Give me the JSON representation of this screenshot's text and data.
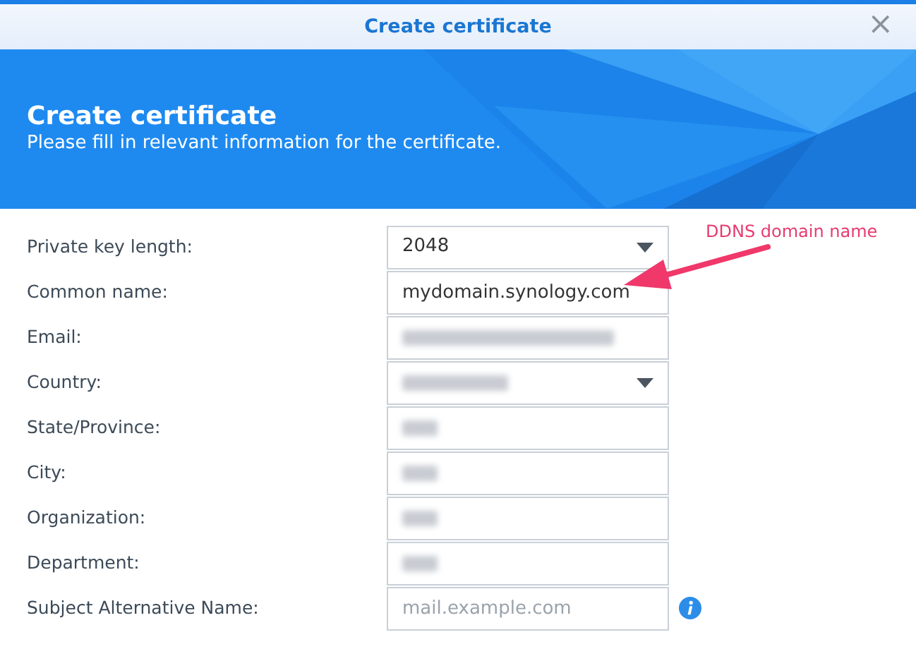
{
  "window": {
    "title": "Create certificate",
    "close": "×"
  },
  "header": {
    "title": "Create certificate",
    "subtitle": "Please fill in relevant information for the certificate."
  },
  "fields": [
    {
      "label": "Private key length:",
      "kind": "select",
      "value": "2048"
    },
    {
      "label": "Common name:",
      "kind": "text",
      "value": "mydomain.synology.com"
    },
    {
      "label": "Email:",
      "kind": "text",
      "redacted": true
    },
    {
      "label": "Country:",
      "kind": "select",
      "redacted": true
    },
    {
      "label": "State/Province:",
      "kind": "text",
      "redacted": true
    },
    {
      "label": "City:",
      "kind": "text",
      "redacted": true
    },
    {
      "label": "Organization:",
      "kind": "text",
      "redacted": true
    },
    {
      "label": "Department:",
      "kind": "text",
      "redacted": true
    },
    {
      "label": "Subject Alternative Name:",
      "kind": "text",
      "placeholder": "mail.example.com",
      "info": true
    }
  ],
  "annotation": {
    "text": "DDNS domain name"
  }
}
